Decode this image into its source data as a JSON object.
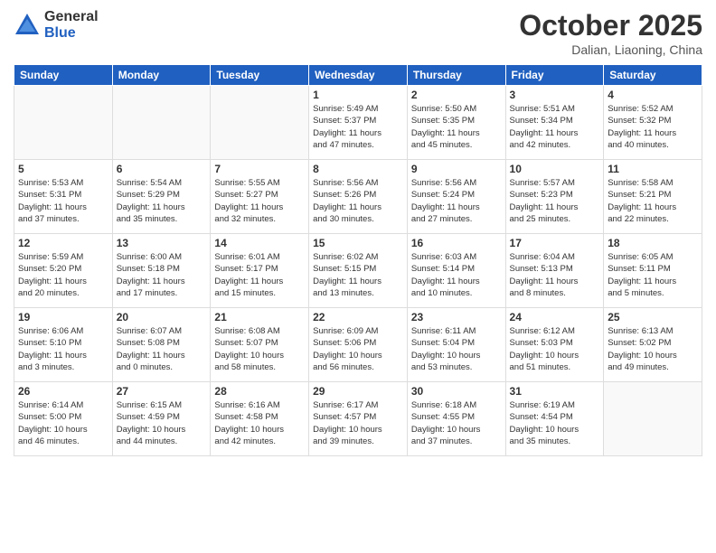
{
  "logo": {
    "general": "General",
    "blue": "Blue"
  },
  "title": "October 2025",
  "location": "Dalian, Liaoning, China",
  "weekdays": [
    "Sunday",
    "Monday",
    "Tuesday",
    "Wednesday",
    "Thursday",
    "Friday",
    "Saturday"
  ],
  "weeks": [
    [
      {
        "day": "",
        "info": ""
      },
      {
        "day": "",
        "info": ""
      },
      {
        "day": "",
        "info": ""
      },
      {
        "day": "1",
        "info": "Sunrise: 5:49 AM\nSunset: 5:37 PM\nDaylight: 11 hours\nand 47 minutes."
      },
      {
        "day": "2",
        "info": "Sunrise: 5:50 AM\nSunset: 5:35 PM\nDaylight: 11 hours\nand 45 minutes."
      },
      {
        "day": "3",
        "info": "Sunrise: 5:51 AM\nSunset: 5:34 PM\nDaylight: 11 hours\nand 42 minutes."
      },
      {
        "day": "4",
        "info": "Sunrise: 5:52 AM\nSunset: 5:32 PM\nDaylight: 11 hours\nand 40 minutes."
      }
    ],
    [
      {
        "day": "5",
        "info": "Sunrise: 5:53 AM\nSunset: 5:31 PM\nDaylight: 11 hours\nand 37 minutes."
      },
      {
        "day": "6",
        "info": "Sunrise: 5:54 AM\nSunset: 5:29 PM\nDaylight: 11 hours\nand 35 minutes."
      },
      {
        "day": "7",
        "info": "Sunrise: 5:55 AM\nSunset: 5:27 PM\nDaylight: 11 hours\nand 32 minutes."
      },
      {
        "day": "8",
        "info": "Sunrise: 5:56 AM\nSunset: 5:26 PM\nDaylight: 11 hours\nand 30 minutes."
      },
      {
        "day": "9",
        "info": "Sunrise: 5:56 AM\nSunset: 5:24 PM\nDaylight: 11 hours\nand 27 minutes."
      },
      {
        "day": "10",
        "info": "Sunrise: 5:57 AM\nSunset: 5:23 PM\nDaylight: 11 hours\nand 25 minutes."
      },
      {
        "day": "11",
        "info": "Sunrise: 5:58 AM\nSunset: 5:21 PM\nDaylight: 11 hours\nand 22 minutes."
      }
    ],
    [
      {
        "day": "12",
        "info": "Sunrise: 5:59 AM\nSunset: 5:20 PM\nDaylight: 11 hours\nand 20 minutes."
      },
      {
        "day": "13",
        "info": "Sunrise: 6:00 AM\nSunset: 5:18 PM\nDaylight: 11 hours\nand 17 minutes."
      },
      {
        "day": "14",
        "info": "Sunrise: 6:01 AM\nSunset: 5:17 PM\nDaylight: 11 hours\nand 15 minutes."
      },
      {
        "day": "15",
        "info": "Sunrise: 6:02 AM\nSunset: 5:15 PM\nDaylight: 11 hours\nand 13 minutes."
      },
      {
        "day": "16",
        "info": "Sunrise: 6:03 AM\nSunset: 5:14 PM\nDaylight: 11 hours\nand 10 minutes."
      },
      {
        "day": "17",
        "info": "Sunrise: 6:04 AM\nSunset: 5:13 PM\nDaylight: 11 hours\nand 8 minutes."
      },
      {
        "day": "18",
        "info": "Sunrise: 6:05 AM\nSunset: 5:11 PM\nDaylight: 11 hours\nand 5 minutes."
      }
    ],
    [
      {
        "day": "19",
        "info": "Sunrise: 6:06 AM\nSunset: 5:10 PM\nDaylight: 11 hours\nand 3 minutes."
      },
      {
        "day": "20",
        "info": "Sunrise: 6:07 AM\nSunset: 5:08 PM\nDaylight: 11 hours\nand 0 minutes."
      },
      {
        "day": "21",
        "info": "Sunrise: 6:08 AM\nSunset: 5:07 PM\nDaylight: 10 hours\nand 58 minutes."
      },
      {
        "day": "22",
        "info": "Sunrise: 6:09 AM\nSunset: 5:06 PM\nDaylight: 10 hours\nand 56 minutes."
      },
      {
        "day": "23",
        "info": "Sunrise: 6:11 AM\nSunset: 5:04 PM\nDaylight: 10 hours\nand 53 minutes."
      },
      {
        "day": "24",
        "info": "Sunrise: 6:12 AM\nSunset: 5:03 PM\nDaylight: 10 hours\nand 51 minutes."
      },
      {
        "day": "25",
        "info": "Sunrise: 6:13 AM\nSunset: 5:02 PM\nDaylight: 10 hours\nand 49 minutes."
      }
    ],
    [
      {
        "day": "26",
        "info": "Sunrise: 6:14 AM\nSunset: 5:00 PM\nDaylight: 10 hours\nand 46 minutes."
      },
      {
        "day": "27",
        "info": "Sunrise: 6:15 AM\nSunset: 4:59 PM\nDaylight: 10 hours\nand 44 minutes."
      },
      {
        "day": "28",
        "info": "Sunrise: 6:16 AM\nSunset: 4:58 PM\nDaylight: 10 hours\nand 42 minutes."
      },
      {
        "day": "29",
        "info": "Sunrise: 6:17 AM\nSunset: 4:57 PM\nDaylight: 10 hours\nand 39 minutes."
      },
      {
        "day": "30",
        "info": "Sunrise: 6:18 AM\nSunset: 4:55 PM\nDaylight: 10 hours\nand 37 minutes."
      },
      {
        "day": "31",
        "info": "Sunrise: 6:19 AM\nSunset: 4:54 PM\nDaylight: 10 hours\nand 35 minutes."
      },
      {
        "day": "",
        "info": ""
      }
    ]
  ]
}
